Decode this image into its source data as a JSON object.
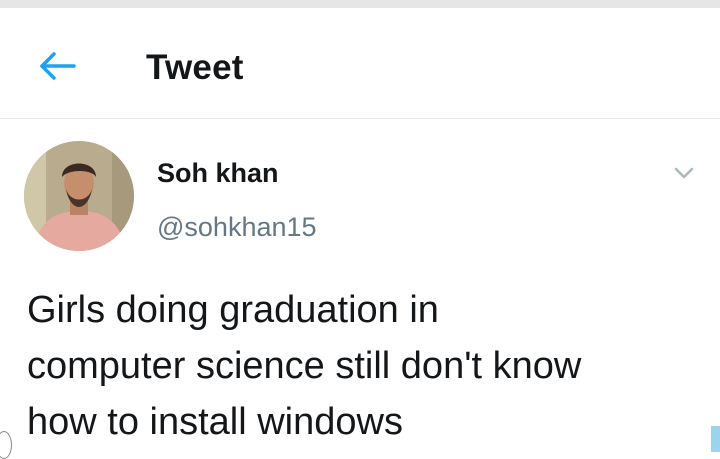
{
  "header": {
    "title": "Tweet",
    "back_icon": "arrow-left-icon"
  },
  "tweet": {
    "author": {
      "display_name": "Soh khan",
      "handle": "@sohkhan15",
      "avatar": "profile-photo"
    },
    "menu_icon": "chevron-down-icon",
    "text": "Girls doing graduation in\ncomputer science still don't know\nhow to install windows"
  },
  "colors": {
    "accent": "#1da1f2",
    "text": "#14171a",
    "secondary_text": "#657786",
    "caret": "#aab8c2",
    "divider": "#e6ecf0"
  }
}
